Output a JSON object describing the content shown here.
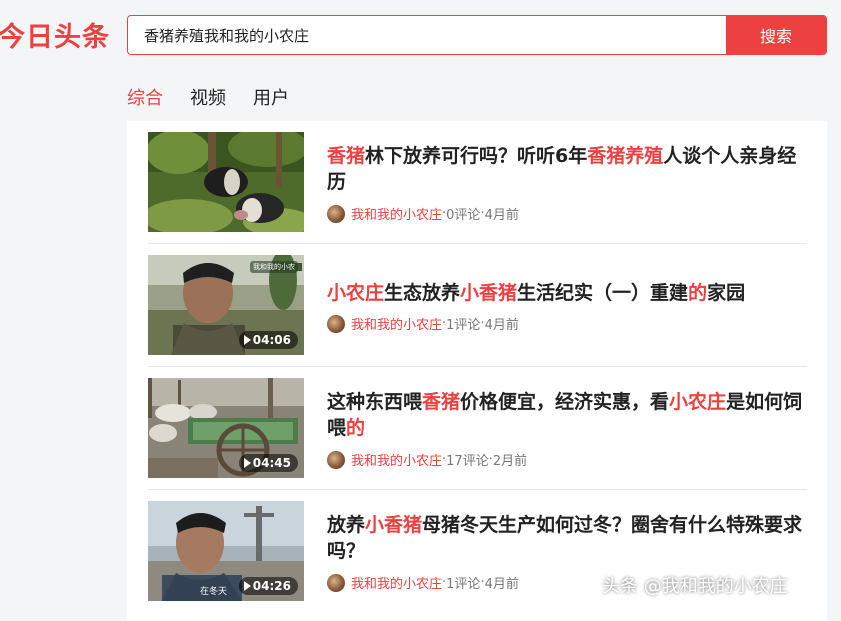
{
  "logo": "今日头条",
  "search": {
    "value": "香猪养殖我和我的小农庄",
    "button_label": "搜索"
  },
  "tabs": [
    {
      "label": "综合",
      "active": true
    },
    {
      "label": "视频",
      "active": false
    },
    {
      "label": "用户",
      "active": false
    }
  ],
  "results": [
    {
      "title_parts": [
        {
          "text": "香猪",
          "hl": true
        },
        {
          "text": "林下放养可行吗？听听6年",
          "hl": false
        },
        {
          "text": "香猪养殖",
          "hl": true
        },
        {
          "text": "人谈个人亲身经历",
          "hl": false
        }
      ],
      "author": "我和我的小农庄",
      "comments": "0评论",
      "time": "4月前",
      "duration": ""
    },
    {
      "title_parts": [
        {
          "text": "小农庄",
          "hl": true
        },
        {
          "text": "生态放养",
          "hl": false
        },
        {
          "text": "小香猪",
          "hl": true
        },
        {
          "text": "生活纪实（一）重建",
          "hl": false
        },
        {
          "text": "的",
          "hl": true
        },
        {
          "text": "家园",
          "hl": false
        }
      ],
      "author": "我和我的小农庄",
      "comments": "1评论",
      "time": "4月前",
      "duration": "04:06",
      "thumb_caption": "我和我的小农"
    },
    {
      "title_parts": [
        {
          "text": "这种东西喂",
          "hl": false
        },
        {
          "text": "香猪",
          "hl": true
        },
        {
          "text": "价格便宜，经济实惠，看",
          "hl": false
        },
        {
          "text": "小农庄",
          "hl": true
        },
        {
          "text": "是如何饲喂",
          "hl": false
        },
        {
          "text": "的",
          "hl": true
        }
      ],
      "author": "我和我的小农庄",
      "comments": "17评论",
      "time": "2月前",
      "duration": "04:45"
    },
    {
      "title_parts": [
        {
          "text": "放养",
          "hl": false
        },
        {
          "text": "小香猪",
          "hl": true
        },
        {
          "text": "母猪冬天生产如何过冬？圈舍有什么特殊要求吗？",
          "hl": false
        }
      ],
      "author": "我和我的小农庄",
      "comments": "1评论",
      "time": "4月前",
      "duration": "04:26",
      "thumb_caption": "在冬天"
    }
  ],
  "meta_separator": " · ",
  "watermark": "头条 @我和我的小农庄",
  "colors": {
    "accent": "#ed4040",
    "background": "#f4f5f6"
  }
}
